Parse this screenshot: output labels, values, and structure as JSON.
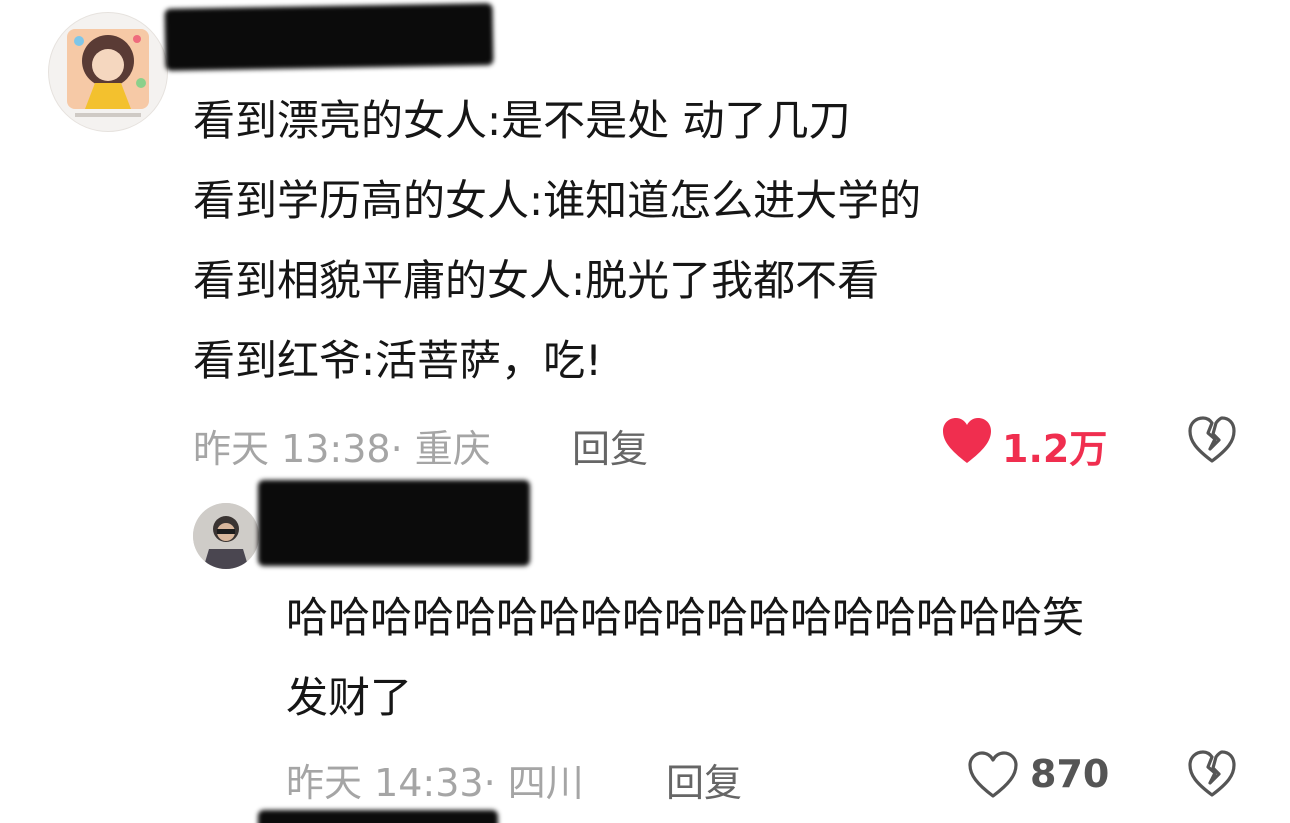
{
  "comment1": {
    "lines": [
      "看到漂亮的女人:是不是处 动了几刀",
      "看到学历高的女人:谁知道怎么进大学的",
      "看到相貌平庸的女人:脱光了我都不看",
      "看到红爷:活菩萨，吃!"
    ],
    "meta": "昨天 13:38· 重庆",
    "reply_label": "回复",
    "like_count": "1.2万",
    "liked": true
  },
  "comment2": {
    "lines": [
      "哈哈哈哈哈哈哈哈哈哈哈哈哈哈哈哈哈哈笑",
      "发财了"
    ],
    "meta": "昨天 14:33· 四川",
    "reply_label": "回复",
    "like_count": "870",
    "liked": false
  },
  "icons": {
    "liked_heart": "heart-filled-icon",
    "heart": "heart-outline-icon",
    "dislike": "broken-heart-icon"
  },
  "colors": {
    "like_red": "#f02e4f",
    "meta_gray": "#a5a5a5",
    "text": "#161616"
  }
}
